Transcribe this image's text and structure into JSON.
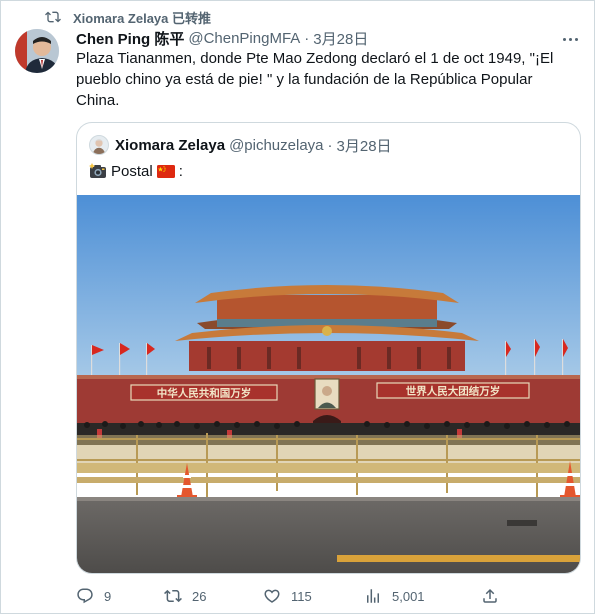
{
  "retweet": {
    "label": "Xiomara Zelaya 已转推"
  },
  "tweet": {
    "author_name": "Chen Ping 陈平",
    "author_handle": "@ChenPingMFA",
    "separator": "·",
    "date": "3月28日",
    "text": "Plaza Tiananmen, donde Pte Mao Zedong declaró el 1 de oct 1949, \"¡El pueblo chino ya está de pie! \" y la fundación de la República Popular China."
  },
  "quote": {
    "author_name": "Xiomara Zelaya",
    "author_handle": "@pichuzelaya",
    "separator": "·",
    "date": "3月28日",
    "text": "Postal",
    "text_suffix": ":",
    "gate_sign_left": "中华人民共和国万岁",
    "gate_sign_right": "世界人民大团结万岁"
  },
  "actions": {
    "replies": "9",
    "retweets": "26",
    "likes": "115",
    "views": "5,001"
  },
  "colors": {
    "secondary_text": "#536471",
    "border": "#cfd9de",
    "primary_text": "#0f1419",
    "gate_red": "#9e3a34"
  },
  "icons": [
    "retweet-icon",
    "more-icon",
    "camera-emoji-icon",
    "china-flag-emoji-icon",
    "reply-icon",
    "like-icon",
    "views-icon",
    "share-icon"
  ]
}
